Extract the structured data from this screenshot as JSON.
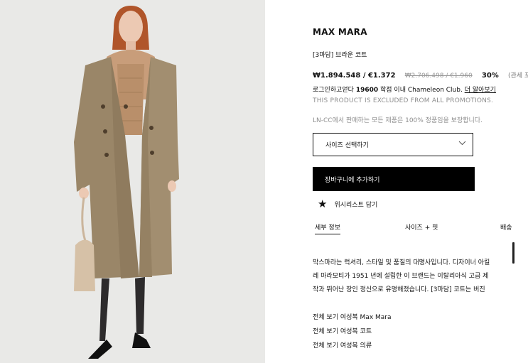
{
  "product": {
    "brand": "MAX MARA",
    "name": "[3마담] 브라운 코트",
    "price_current": "₩1.894.548 / €1.372",
    "price_original": "₩2.706.498 / €1.960",
    "discount": "30%",
    "tax_note": "(관세 포함)"
  },
  "club": {
    "prefix": "로그인하고얻다 ",
    "points": "19600",
    "suffix": " 학점 이내 Chameleon Club. ",
    "link": "더 알아보기"
  },
  "excluded_note": "THIS PRODUCT IS EXCLUDED FROM ALL PROMOTIONS.",
  "guarantee": "LN-CC에서 판매하는 모든 제품은 100% 정품임을 보장합니다.",
  "size_select": {
    "label": "사이즈 선택하기",
    "icon": "chevron-down-icon"
  },
  "add_to_cart": "장바구니에 추가하기",
  "wishlist": {
    "label": "위시리스트 담기",
    "icon": "star-icon"
  },
  "tabs": [
    {
      "label": "세부 정보",
      "active": true
    },
    {
      "label": "사이즈 + 핏",
      "active": false
    },
    {
      "label": "배송",
      "active": false
    }
  ],
  "description": [
    "막스마라는 럭셔리, 스타일 및 품질의 대명사입니다. 디자이너 아킬",
    "레 마라모티가 1951 년에 설립한 이 브랜드는 이탈리아식 고급 제",
    "작과 뛰어난 장인 정신으로 유명해졌습니다. [3마담] 코트는 버진"
  ],
  "links": [
    "전체 보기 여성복 Max Mara",
    "전체 보기 여성복 코트",
    "전체 보기 여성복 의류"
  ]
}
